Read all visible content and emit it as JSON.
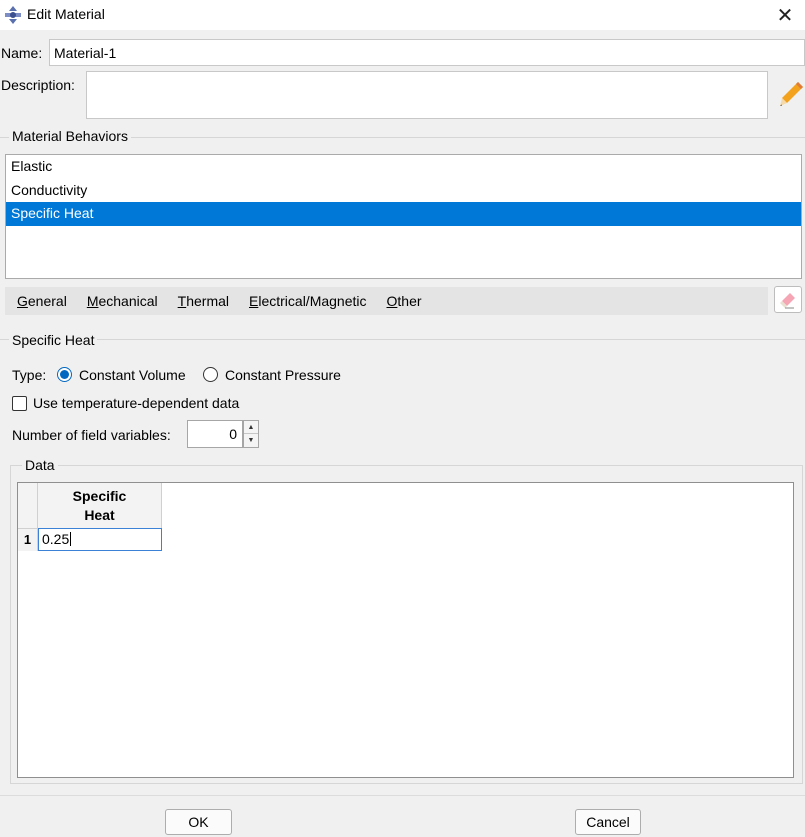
{
  "window": {
    "title": "Edit Material"
  },
  "name": {
    "label": "Name:",
    "value": "Material-1"
  },
  "description": {
    "label": "Description:",
    "value": ""
  },
  "behaviors": {
    "title": "Material Behaviors",
    "items": [
      {
        "label": "Elastic",
        "selected": false
      },
      {
        "label": "Conductivity",
        "selected": false
      },
      {
        "label": "Specific Heat",
        "selected": true
      }
    ]
  },
  "menu": {
    "items": [
      "General",
      "Mechanical",
      "Thermal",
      "Electrical/Magnetic",
      "Other"
    ]
  },
  "specific_heat": {
    "title": "Specific Heat",
    "type_label": "Type:",
    "options": [
      {
        "label": "Constant Volume",
        "checked": true
      },
      {
        "label": "Constant Pressure",
        "checked": false
      }
    ],
    "temp_dependent_label": "Use temperature-dependent data",
    "temp_dependent_checked": false,
    "field_vars_label": "Number of field variables:",
    "field_vars_value": "0"
  },
  "data_table": {
    "title": "Data",
    "column_header": "Specific\nHeat",
    "rows": [
      {
        "index": "1",
        "value": "0.25"
      }
    ]
  },
  "buttons": {
    "ok": "OK",
    "cancel": "Cancel"
  },
  "icons": {
    "app": "abaqus-app-icon",
    "close": "close-icon",
    "edit": "pencil-icon",
    "delete": "eraser-icon"
  },
  "colors": {
    "selection": "#0078d7",
    "radio_accent": "#0067c0"
  }
}
